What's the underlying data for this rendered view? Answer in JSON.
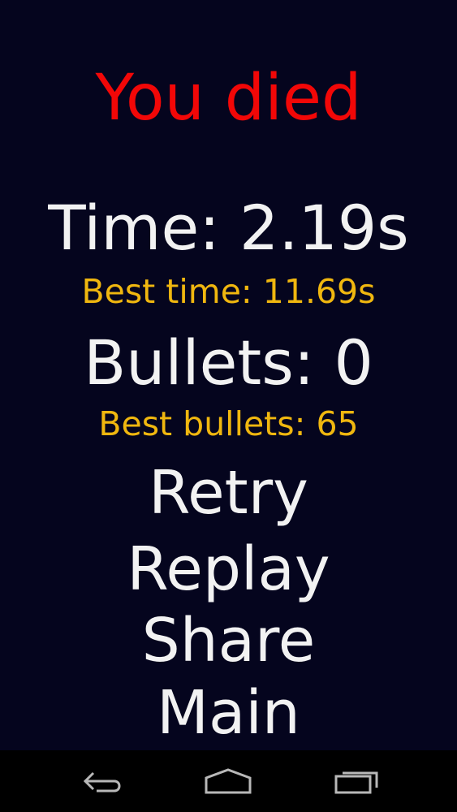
{
  "header": {
    "title": "You died"
  },
  "stats": {
    "time_label": "Time: 2.19s",
    "best_time_label": "Best time: 11.69s",
    "bullets_label": "Bullets: 0",
    "best_bullets_label": "Best bullets: 65"
  },
  "menu": {
    "retry_label": "Retry",
    "replay_label": "Replay",
    "share_label": "Share",
    "main_label": "Main"
  },
  "colors": {
    "background": "#05051e",
    "title": "#f20707",
    "stat_text": "#f2f2f2",
    "best_text": "#f0b70f",
    "navbar": "#000000",
    "nav_icon": "#b8b8b8"
  },
  "navigation_bar": {
    "icons": [
      "back-icon",
      "home-icon",
      "recent-apps-icon"
    ]
  }
}
